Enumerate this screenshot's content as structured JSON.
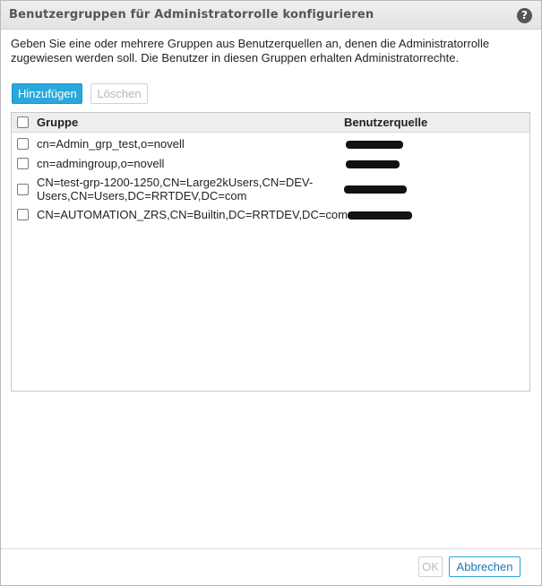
{
  "dialog": {
    "title": "Benutzergruppen für Administratorrolle konfigurieren",
    "help_icon": "?",
    "description": "Geben Sie eine oder mehrere Gruppen aus Benutzerquellen an, denen die Administratorrolle zugewiesen werden soll. Die Benutzer in diesen Gruppen erhalten Administratorrechte."
  },
  "toolbar": {
    "add_label": "Hinzufügen",
    "delete_label": "Löschen"
  },
  "table": {
    "columns": [
      "Gruppe",
      "Benutzerquelle"
    ],
    "rows": [
      {
        "group_line1": "cn=Admin_grp_test,o=novell",
        "group_line2": ""
      },
      {
        "group_line1": "cn=admingroup,o=novell",
        "group_line2": ""
      },
      {
        "group_line1": "CN=test-grp-1200-1250,CN=Large2kUsers,CN=DEV-",
        "group_line2": "Users,CN=Users,DC=RRTDEV,DC=com"
      },
      {
        "group_line1": "CN=AUTOMATION_ZRS,CN=Builtin,DC=RRTDEV,DC=com",
        "group_line2": ""
      }
    ]
  },
  "footer": {
    "ok_label": "OK",
    "cancel_label": "Abbrechen"
  },
  "colors": {
    "accent": "#2aa7dc",
    "header_bg": "#eeeeee",
    "title_text": "#555555"
  }
}
